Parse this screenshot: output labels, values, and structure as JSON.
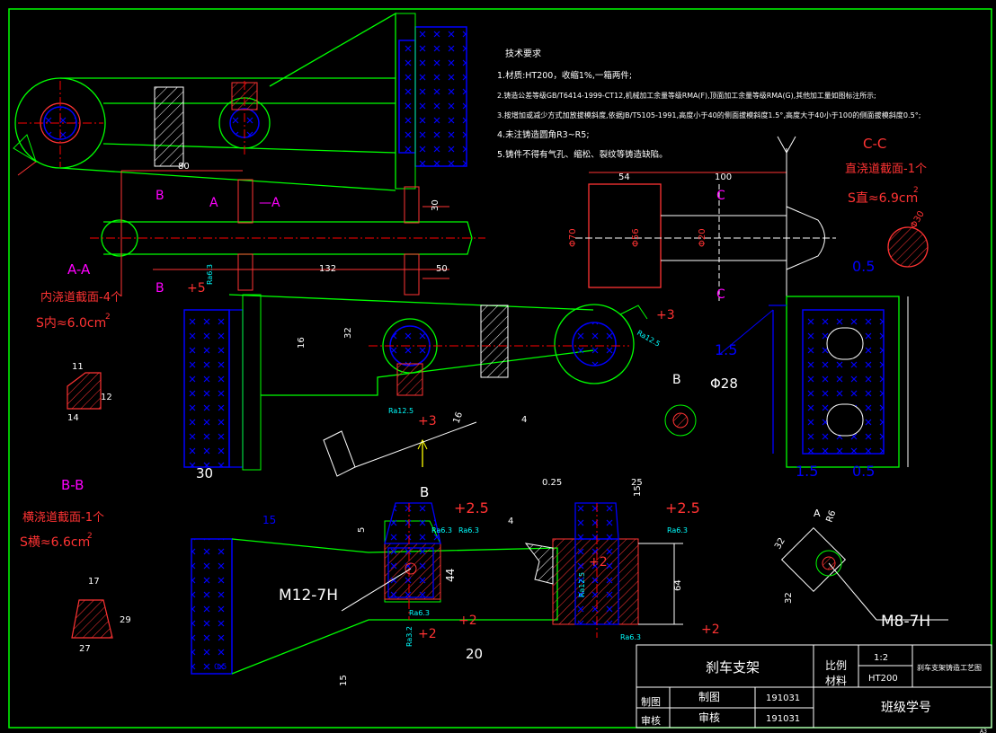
{
  "colors": {
    "background": "#000000",
    "frame": "#00ff00",
    "section_label": "#ff00ff",
    "dimension": "#ffffff",
    "center_line": "#ff0000",
    "annotation": "#ff3333",
    "hatch": "#0000ff",
    "roughness": "#00ffff"
  },
  "tech_requirements": {
    "heading": "技术要求",
    "items": [
      "1.材质:HT200，收缩1%,一箱两件;",
      "2.铸造公差等级GB/T6414-1999-CT12,机械加工余量等级RMA(F),顶面加工余量等级RMA(G),其他加工量如图标注所示;",
      "3.按增加或减少方式加放拔模斜度,依据JB/T5105-1991,高度小于40的侧面拔模斜度1.5°,高度大于40小于100的侧面拔模斜度0.5°;",
      "4.未注铸造圆角R3~R5;",
      "5.铸件不得有气孔、缩松、裂纹等铸造缺陷。"
    ]
  },
  "sections": {
    "aa": {
      "title": "A-A",
      "desc": "内浇道截面-4个",
      "area": "S内≈6.0cm",
      "sup": "2",
      "dims": [
        "11",
        "12",
        "14"
      ]
    },
    "bb": {
      "title": "B-B",
      "desc": "横浇道截面-1个",
      "area": "S横≈6.6cm",
      "sup": "2",
      "dims": [
        "17",
        "29",
        "27"
      ]
    },
    "cc": {
      "title": "C-C",
      "desc": "直浇道截面-1个",
      "area": "S直≈6.9cm",
      "sup": "2",
      "dims": [
        "Φ30"
      ]
    }
  },
  "view_labels": {
    "a_left": "A",
    "a_right": "—A",
    "b_top": "B",
    "b_bottom": "B",
    "b_mid": "B",
    "b_circle": "B",
    "c_top": "C",
    "c_bottom": "C",
    "a_detail": "A",
    "r6": "R6"
  },
  "dimensions": {
    "d80": "80",
    "d30": "30",
    "d132": "132",
    "d50": "50",
    "d54": "54",
    "d100": "100",
    "phi70": "Φ70",
    "phi56": "Φ56",
    "phi20": "Φ20",
    "d16": "16",
    "d32": "32",
    "d16b": "16",
    "d4": "4",
    "d30b": "30",
    "d15": "15",
    "d05": "0.5",
    "phi28": "Φ28",
    "d15c": "1.5",
    "d05b": "0.5",
    "d15d": "1.5",
    "d05c": "0.5",
    "d44": "44",
    "d64": "64",
    "d20": "20",
    "d25": "25",
    "d025": "0.25",
    "d4b": "4",
    "d15e": "15",
    "d32b": "32",
    "d32c": "32",
    "d5": "5",
    "d15f": "15"
  },
  "allowances": [
    "+5",
    "+3",
    "+3",
    "+2.5",
    "+2.5",
    "+2",
    "+2",
    "+2",
    "+2"
  ],
  "roughness": [
    "Ra6.3",
    "Ra6.3",
    "Ra12.5",
    "Ra12.5",
    "Ra6.3",
    "Ra6.3",
    "Ra6.3",
    "Ra12.5",
    "Ra3.2",
    "Ra6.3"
  ],
  "threads": {
    "m12": "M12-7H",
    "m8": "M8-7H"
  },
  "title_block": {
    "part_name": "刹车支架",
    "scale_label": "比例",
    "scale_value": "1:2",
    "material_label": "材料",
    "material_value": "HT200",
    "drawing_name": "刹车支架铸造工艺图",
    "drawn_label": "制图",
    "drawn_value": "制图",
    "drawn_date": "191031",
    "check_label": "审核",
    "check_value": "审核",
    "check_date": "191031",
    "class_id": "班级学号",
    "sheet": "A3"
  }
}
